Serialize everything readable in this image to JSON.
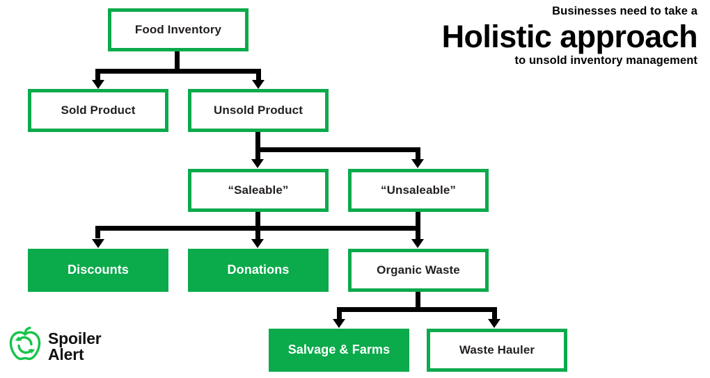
{
  "headline": {
    "kicker": "Businesses need to take a",
    "title": "Holistic approach",
    "subtitle": "to unsold inventory management"
  },
  "logo": {
    "icon": "apple-recycle-icon",
    "line1": "Spoiler",
    "line2": "Alert"
  },
  "colors": {
    "brand_green": "#0BAA4B",
    "fill_green": "#00A94F",
    "connector_black": "#000000",
    "text_dark": "#231f20",
    "background": "#ffffff"
  },
  "diagram": {
    "type": "flowchart",
    "nodes": [
      {
        "id": "food-inventory",
        "label": "Food Inventory",
        "style": "outline",
        "level": 0
      },
      {
        "id": "sold-product",
        "label": "Sold Product",
        "style": "outline",
        "level": 1
      },
      {
        "id": "unsold-product",
        "label": "Unsold Product",
        "style": "outline",
        "level": 1
      },
      {
        "id": "saleable",
        "label": "“Saleable”",
        "style": "outline",
        "level": 2
      },
      {
        "id": "unsaleable",
        "label": "“Unsaleable”",
        "style": "outline",
        "level": 2
      },
      {
        "id": "discounts",
        "label": "Discounts",
        "style": "filled",
        "level": 3
      },
      {
        "id": "donations",
        "label": "Donations",
        "style": "filled",
        "level": 3
      },
      {
        "id": "organic-waste",
        "label": "Organic Waste",
        "style": "outline",
        "level": 3
      },
      {
        "id": "salvage-farms",
        "label": "Salvage & Farms",
        "style": "filled",
        "level": 4
      },
      {
        "id": "waste-hauler",
        "label": "Waste Hauler",
        "style": "outline",
        "level": 4
      }
    ],
    "edges": [
      {
        "from": "food-inventory",
        "to": "sold-product"
      },
      {
        "from": "food-inventory",
        "to": "unsold-product"
      },
      {
        "from": "unsold-product",
        "to": "saleable"
      },
      {
        "from": "unsold-product",
        "to": "unsaleable"
      },
      {
        "from": "saleable",
        "to": "discounts"
      },
      {
        "from": "saleable",
        "to": "donations"
      },
      {
        "from": "unsaleable",
        "to": "discounts"
      },
      {
        "from": "unsaleable",
        "to": "donations"
      },
      {
        "from": "unsaleable",
        "to": "organic-waste"
      },
      {
        "from": "organic-waste",
        "to": "salvage-farms"
      },
      {
        "from": "organic-waste",
        "to": "waste-hauler"
      }
    ]
  }
}
